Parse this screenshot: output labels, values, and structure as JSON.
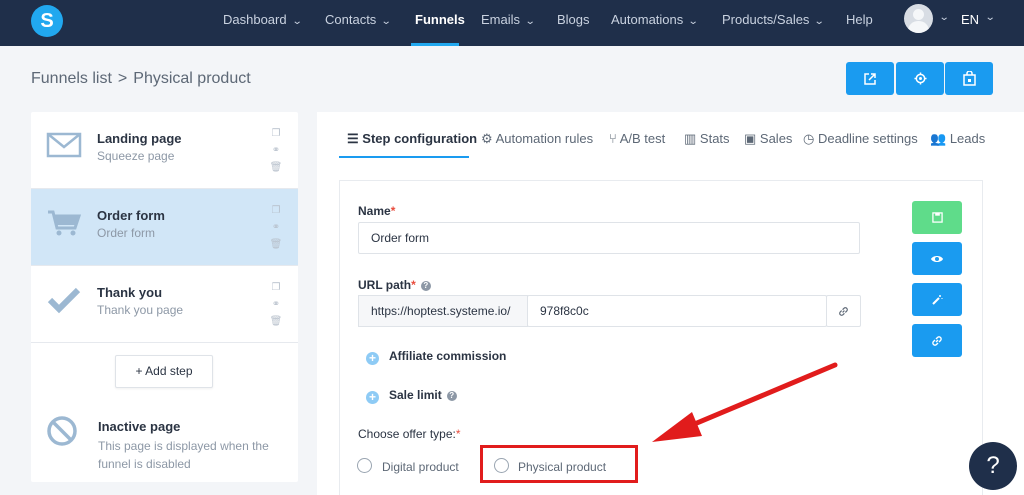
{
  "nav": {
    "logo_letter": "S",
    "items": [
      {
        "label": "Dashboard",
        "has_chevron": true
      },
      {
        "label": "Contacts",
        "has_chevron": true
      },
      {
        "label": "Funnels",
        "has_chevron": false,
        "active": true
      },
      {
        "label": "Emails",
        "has_chevron": true
      },
      {
        "label": "Blogs",
        "has_chevron": false
      },
      {
        "label": "Automations",
        "has_chevron": true
      },
      {
        "label": "Products/Sales",
        "has_chevron": true
      },
      {
        "label": "Help",
        "has_chevron": false
      }
    ],
    "language": "EN"
  },
  "breadcrumb": {
    "parent": "Funnels list",
    "separator": ">",
    "current": "Physical product"
  },
  "header_buttons": [
    "external-link-icon",
    "gear-icon",
    "shopping-bag-icon"
  ],
  "steps": [
    {
      "title": "Landing page",
      "subtitle": "Squeeze page",
      "icon": "envelope-icon",
      "active": false
    },
    {
      "title": "Order form",
      "subtitle": "Order form",
      "icon": "cart-icon",
      "active": true
    },
    {
      "title": "Thank you",
      "subtitle": "Thank you page",
      "icon": "checkmark-icon",
      "active": false
    }
  ],
  "add_step_label": "+ Add step",
  "inactive_page": {
    "title": "Inactive page",
    "description": "This page is displayed when the funnel is disabled"
  },
  "tabs": [
    {
      "label": "Step configuration",
      "icon": "list-icon",
      "active": true
    },
    {
      "label": "Automation rules",
      "icon": "gears-icon",
      "active": false
    },
    {
      "label": "A/B test",
      "icon": "split-icon",
      "active": false
    },
    {
      "label": "Stats",
      "icon": "bar-chart-icon",
      "active": false
    },
    {
      "label": "Sales",
      "icon": "money-icon",
      "active": false
    },
    {
      "label": "Deadline settings",
      "icon": "clock-icon",
      "active": false
    },
    {
      "label": "Leads",
      "icon": "users-icon",
      "active": false
    }
  ],
  "form": {
    "name_label": "Name",
    "name_value": "Order form",
    "url_label": "URL path",
    "url_prefix": "https://hoptest.systeme.io/",
    "url_value": "978f8c0c",
    "affiliate_label": "Affiliate commission",
    "sale_limit_label": "Sale limit",
    "offer_type_label": "Choose offer type:",
    "offer_options": [
      "Digital product",
      "Physical product"
    ]
  },
  "side_buttons": [
    "save-icon",
    "eye-icon",
    "magic-wand-icon",
    "link-icon"
  ],
  "help_button": "?",
  "colors": {
    "nav_bg": "#1f2f4a",
    "accent": "#1a9bf0",
    "save_green": "#5fdc8a",
    "active_step": "#d1e6f7",
    "annotation_red": "#e11c1c"
  }
}
